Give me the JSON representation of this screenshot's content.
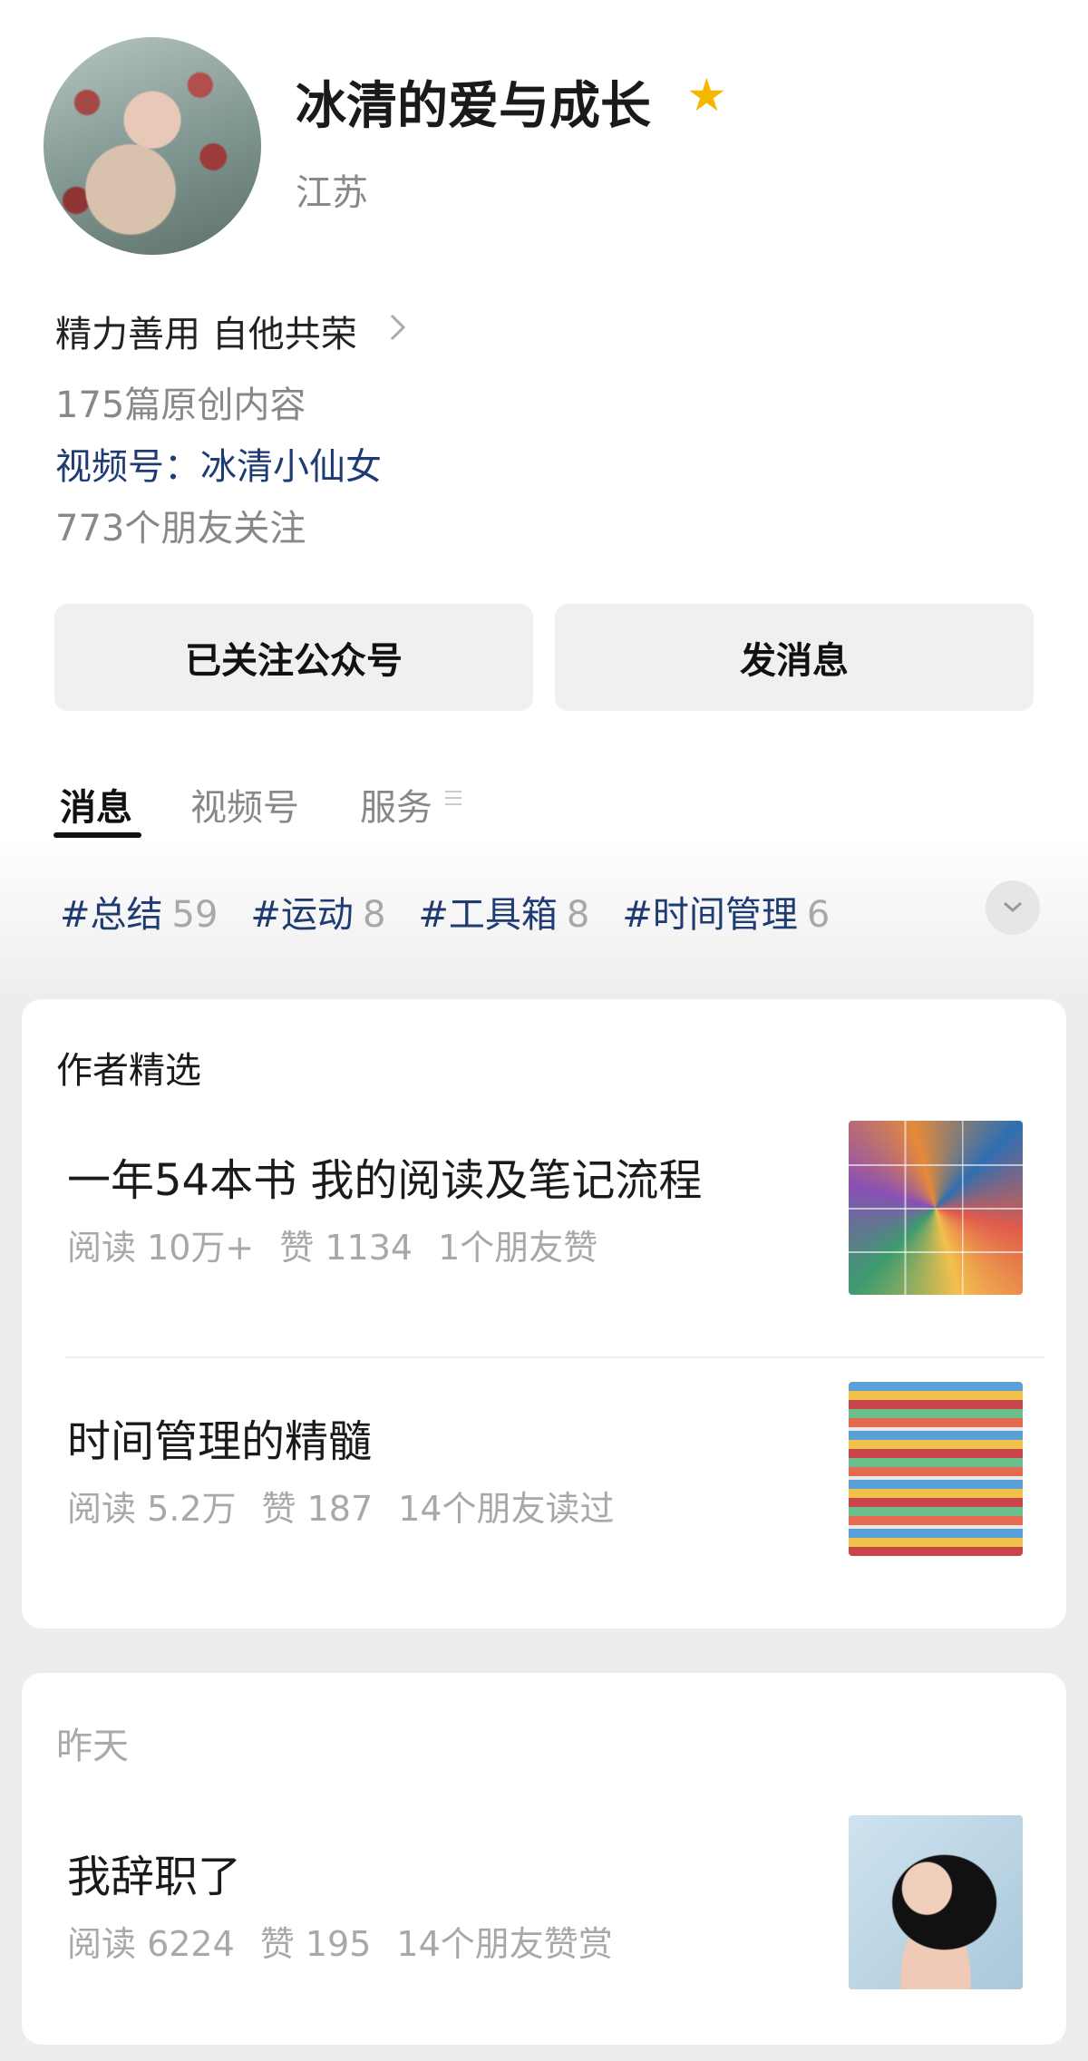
{
  "profile": {
    "name": "冰清的爱与成长",
    "region": "江苏",
    "intro": "精力善用 自他共荣",
    "original_count": "175篇原创内容",
    "video_channel": "视频号：冰清小仙女",
    "friends_following": "773个朋友关注",
    "star_icon": "star-icon",
    "star_color": "#f5b800"
  },
  "actions": {
    "follow_label": "已关注公众号",
    "message_label": "发消息"
  },
  "tabs": [
    {
      "label": "消息",
      "active": true
    },
    {
      "label": "视频号",
      "active": false
    },
    {
      "label": "服务",
      "active": false
    }
  ],
  "tags": [
    {
      "name": "#总结",
      "count": "59"
    },
    {
      "name": "#运动",
      "count": "8"
    },
    {
      "name": "#工具箱",
      "count": "8"
    },
    {
      "name": "#时间管理",
      "count": "6"
    }
  ],
  "featured": {
    "title": "作者精选",
    "articles": [
      {
        "title": "一年54本书 我的阅读及笔记流程",
        "reads": "阅读 10万+",
        "likes": "赞 1134",
        "social": "1个朋友赞"
      },
      {
        "title": "时间管理的精髓",
        "reads": "阅读 5.2万",
        "likes": "赞 187",
        "social": "14个朋友读过"
      }
    ]
  },
  "recent": {
    "date_label": "昨天",
    "articles": [
      {
        "title": "我辞职了",
        "reads": "阅读 6224",
        "likes": "赞 195",
        "social": "14个朋友赞赏"
      }
    ]
  },
  "colors": {
    "link_blue": "#1f3b73",
    "muted": "#a8a8a8"
  }
}
